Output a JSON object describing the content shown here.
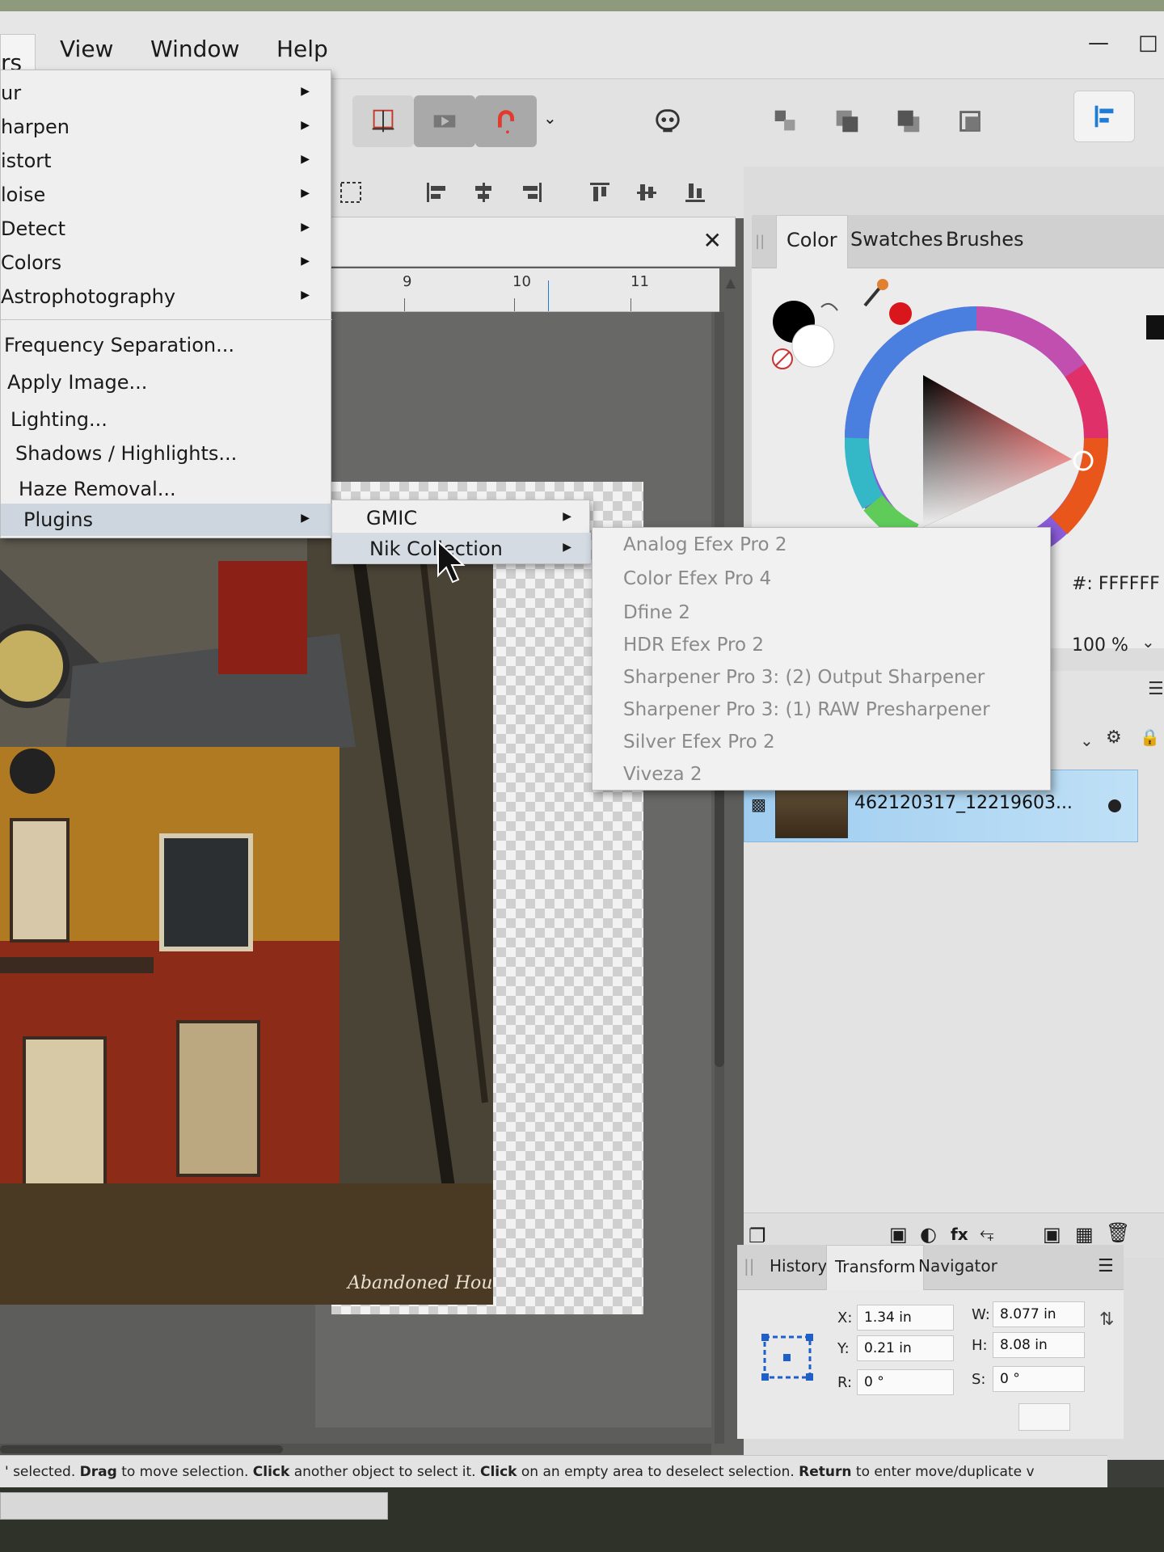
{
  "menubar": {
    "filters_partial": "rs",
    "items": [
      "View",
      "Window",
      "Help"
    ]
  },
  "filters_menu": {
    "submenu_items": [
      "ur",
      "harpen",
      "istort",
      "loise",
      "Detect",
      "Colors",
      "Astrophotography"
    ],
    "dialog_items": [
      "Frequency Separation...",
      "Apply Image...",
      "Lighting...",
      "Shadows / Highlights...",
      "Haze Removal...",
      "Plugins"
    ]
  },
  "plugins_submenu": {
    "items": [
      "GMIC",
      "Nik Collection"
    ]
  },
  "nik_submenu": {
    "items": [
      "Analog Efex Pro 2",
      "Color Efex Pro 4",
      "Dfine 2",
      "HDR Efex Pro 2",
      "Sharpener Pro 3: (2) Output Sharpener",
      "Sharpener Pro 3: (1) RAW Presharpener",
      "Silver Efex Pro 2",
      "Viveza 2"
    ]
  },
  "ruler": {
    "labels": [
      "9",
      "10",
      "11"
    ]
  },
  "color_panel": {
    "tabs": [
      "Color",
      "Swatches",
      "Brushes"
    ],
    "hex": "#: FFFFFF",
    "opacity": "100 %",
    "primary_color": "#000000",
    "secondary_color": "#ffffff",
    "accent_color": "#cc1a1a"
  },
  "layers": {
    "layer_name": "462120317_12219603..."
  },
  "transform_panel": {
    "tabs": [
      "History",
      "Transform",
      "Navigator"
    ],
    "x_label": "X:",
    "x_value": "1.34 in",
    "y_label": "Y:",
    "y_value": "0.21 in",
    "w_label": "W:",
    "w_value": "8.077 in",
    "h_label": "H:",
    "h_value": "8.08 in",
    "r_label": "R:",
    "r_value": "0 °",
    "s_label": "S:",
    "s_value": "0 °"
  },
  "status": {
    "part1": "' selected. ",
    "b1": "Drag",
    "part2": " to move selection. ",
    "b2": "Click",
    "part3": " another object to select it. ",
    "b3": "Click",
    "part4": " on an empty area to deselect selection. ",
    "b4": "Return",
    "part5": " to enter move/duplicate v"
  },
  "photo_watermark": "Abandoned Houses"
}
